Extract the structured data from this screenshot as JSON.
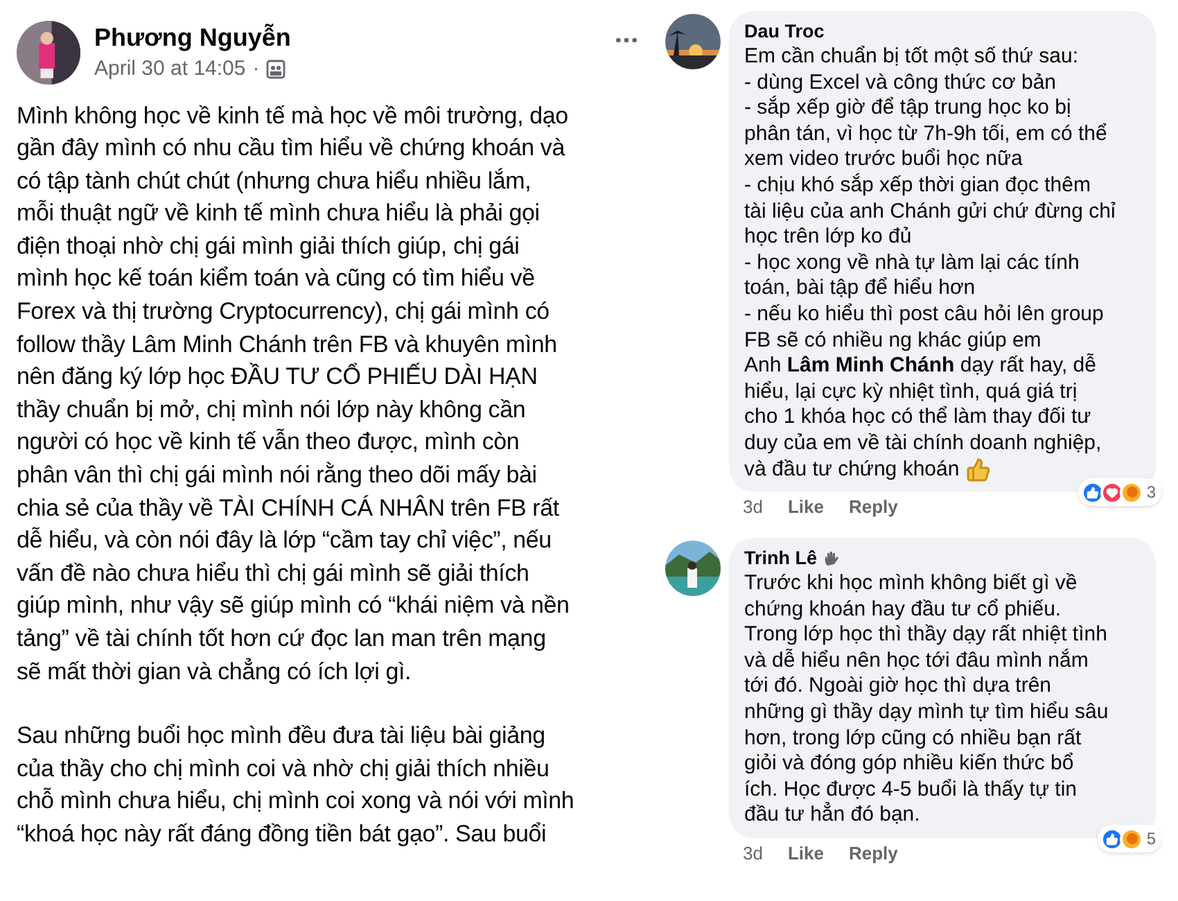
{
  "post": {
    "author": "Phương Nguyễn",
    "time": "April 30 at 14:05",
    "separator": "·",
    "paragraphs": [
      [
        "Mình không học về kinh tế mà học về môi trường, dạo",
        "gần đây mình có nhu cầu tìm hiểu về chứng khoán và",
        "có tập tành chút chút (nhưng chưa hiểu nhiều lắm,",
        "mỗi thuật ngữ về kinh tế mình chưa hiểu là phải gọi",
        "điện thoại nhờ chị gái mình giải thích giúp, chị gái",
        "mình học kế toán kiểm toán và cũng có tìm hiểu về",
        "Forex và thị trường Cryptocurrency), chị gái mình có",
        "follow thầy Lâm Minh Chánh trên FB và khuyên mình",
        "nên đăng ký lớp học ĐẦU TƯ CỔ PHIẾU DÀI HẠN",
        "thầy chuẩn bị mở, chị mình nói lớp này không cần",
        "người có học về kinh tế vẫn theo được, mình còn",
        "phân vân thì chị gái mình nói rằng theo dõi mấy bài",
        "chia sẻ của thầy về TÀI CHÍNH CÁ NHÂN trên FB rất",
        "dễ hiểu, và còn nói đây là lớp “cầm tay chỉ việc”, nếu",
        "vấn đề nào chưa hiểu thì chị gái mình sẽ giải thích",
        "giúp mình, như vậy sẽ giúp mình có “khái niệm và nền",
        "tảng” về tài chính tốt hơn cứ đọc lan man trên mạng",
        "sẽ mất thời gian và chẳng có ích lợi gì."
      ],
      [
        "Sau những buổi học mình đều đưa tài liệu bài giảng",
        "của thầy cho chị mình coi và nhờ chị giải thích nhiều",
        "chỗ mình chưa hiểu, chị mình coi xong và nói với mình",
        "“khoá học này rất đáng đồng tiền bát gạo”. Sau buổi"
      ]
    ]
  },
  "comments": [
    {
      "author": "Dau Troc",
      "author_badge": false,
      "thumbs_emoji": true,
      "lines": [
        "Em cần chuẩn bị tốt một số thứ sau:",
        "- dùng Excel và công thức cơ bản",
        "- sắp xếp giờ để tập trung học ko bị",
        "phân tán, vì học từ 7h-9h tối, em có thể",
        "xem video trước buổi học nữa",
        "- chịu khó sắp xếp thời gian đọc thêm",
        "tài liệu của anh Chánh gửi chứ đừng chỉ",
        "học trên lớp ko đủ",
        "- học xong về nhà tự làm lại các tính",
        "toán, bài tập để hiểu hơn",
        "- nếu ko hiểu thì post câu hỏi lên group",
        "FB sẽ có nhiều ng khác giúp em",
        "Anh **Lâm Minh Chánh** dạy rất hay, dễ",
        "hiểu, lại cực kỳ nhiệt tình, quá giá trị",
        "cho 1 khóa học có thể làm thay đối tư",
        "duy của em về tài chính doanh nghiệp,",
        "và đầu tư chứng khoán"
      ],
      "age": "3d",
      "actions": [
        "Like",
        "Reply"
      ],
      "reactions": [
        {
          "kind": "like"
        },
        {
          "kind": "love"
        },
        {
          "kind": "care"
        }
      ],
      "reaction_count": "3"
    },
    {
      "author": "Trinh Lê",
      "author_badge": true,
      "thumbs_emoji": false,
      "lines": [
        "Trước khi học mình không biết gì về",
        "chứng khoán hay đầu tư cổ phiếu.",
        "Trong lớp học thì thầy dạy rất nhiệt tình",
        "và dễ hiểu nên học tới đâu mình nắm",
        "tới đó. Ngoài giờ học thì dựa trên",
        "những gì thầy dạy mình tự tìm hiểu sâu",
        "hơn, trong lớp cũng có nhiều bạn rất",
        "giỏi và đóng góp nhiều kiến thức bổ",
        "ích. Học được 4-5 buổi là thấy tự tin",
        "đầu tư hẳn đó bạn."
      ],
      "age": "3d",
      "actions": [
        "Like",
        "Reply"
      ],
      "reactions": [
        {
          "kind": "like"
        },
        {
          "kind": "care"
        }
      ],
      "reaction_count": "5"
    }
  ]
}
